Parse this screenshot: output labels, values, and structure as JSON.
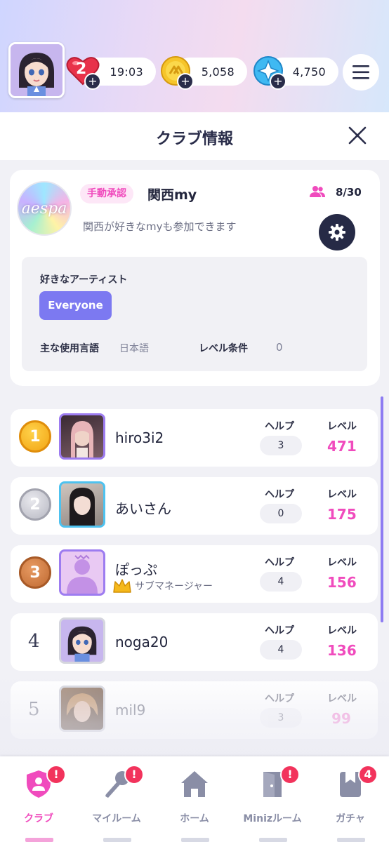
{
  "resources": {
    "hearts_count": "2",
    "timer": "19:03",
    "coins": "5,058",
    "gems": "4,750"
  },
  "panel": {
    "title": "クラブ情報"
  },
  "club": {
    "logo_text": "aespa",
    "approval_badge": "手動承認",
    "name": "関西my",
    "member_count": "8/30",
    "description": "関西が好きなmyも参加できます",
    "favorite_artist_label": "好きなアーティスト",
    "favorite_artist": "Everyone",
    "language_label": "主な使用言語",
    "language": "日本語",
    "level_req_label": "レベル条件",
    "level_req": "0"
  },
  "members": [
    {
      "rank": "1",
      "name": "hiro3i2",
      "role": "",
      "help_label": "ヘルプ",
      "help": "3",
      "level_label": "レベル",
      "level": "471"
    },
    {
      "rank": "2",
      "name": "あいさん",
      "role": "",
      "help_label": "ヘルプ",
      "help": "0",
      "level_label": "レベル",
      "level": "175"
    },
    {
      "rank": "3",
      "name": "ぽっぷ",
      "role": "サブマネージャー",
      "help_label": "ヘルプ",
      "help": "4",
      "level_label": "レベル",
      "level": "156"
    },
    {
      "rank": "4",
      "name": "noga20",
      "role": "",
      "help_label": "ヘルプ",
      "help": "4",
      "level_label": "レベル",
      "level": "136"
    },
    {
      "rank": "5",
      "name": "mil9",
      "role": "",
      "help_label": "ヘルプ",
      "help": "3",
      "level_label": "レベル",
      "level": "99"
    }
  ],
  "nav": [
    {
      "label": "クラブ",
      "icon": "club-shield-icon",
      "badge": "!"
    },
    {
      "label": "マイルーム",
      "icon": "microphone-icon",
      "badge": "!"
    },
    {
      "label": "ホーム",
      "icon": "home-icon",
      "badge": ""
    },
    {
      "label": "Minizルーム",
      "icon": "door-icon",
      "badge": "!"
    },
    {
      "label": "ガチャ",
      "icon": "gacha-bookmark-icon",
      "badge": "4"
    }
  ],
  "colors": {
    "accent_pink": "#f04bbd",
    "accent_purple": "#7c79f1",
    "dark_navy": "#262a46",
    "alert_red": "#f2335c"
  }
}
